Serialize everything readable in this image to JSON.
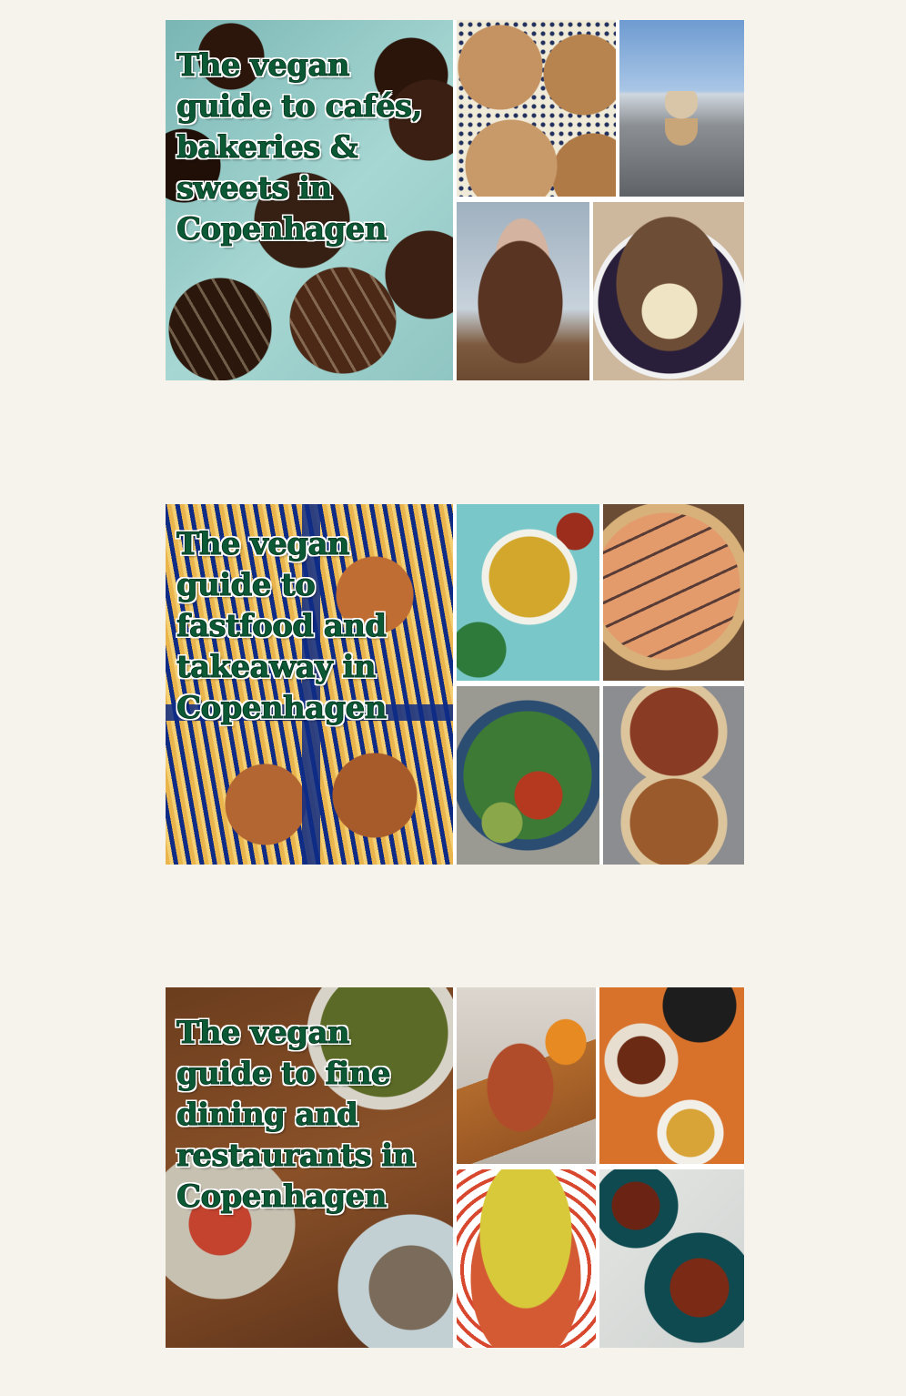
{
  "guides": [
    {
      "title": "The vegan guide to cafés, bakeries & sweets in Copenhagen",
      "images": [
        "chocolate-truffles-photo",
        "sourdough-bread-photo",
        "ice-cream-harbour-photo",
        "pancake-stack-photo",
        "smoothie-bowl-photo"
      ]
    },
    {
      "title": "The vegan guide to fastfood and takeaway in Copenhagen",
      "images": [
        "burgers-and-fries-photo",
        "curry-bowls-photo",
        "pizza-photo",
        "salad-bowl-photo",
        "burrito-wraps-photo"
      ]
    },
    {
      "title": "The vegan guide to fine dining and restaurants in Copenhagen",
      "images": [
        "fine-dining-table-photo",
        "open-sandwich-photo",
        "small-plates-orange-table-photo",
        "pasta-dish-photo",
        "glazed-wings-photo"
      ]
    }
  ],
  "colors": {
    "page_background": "#f6f3ec",
    "title_fill": "#0b5a35",
    "title_outline": "#ffffff"
  }
}
